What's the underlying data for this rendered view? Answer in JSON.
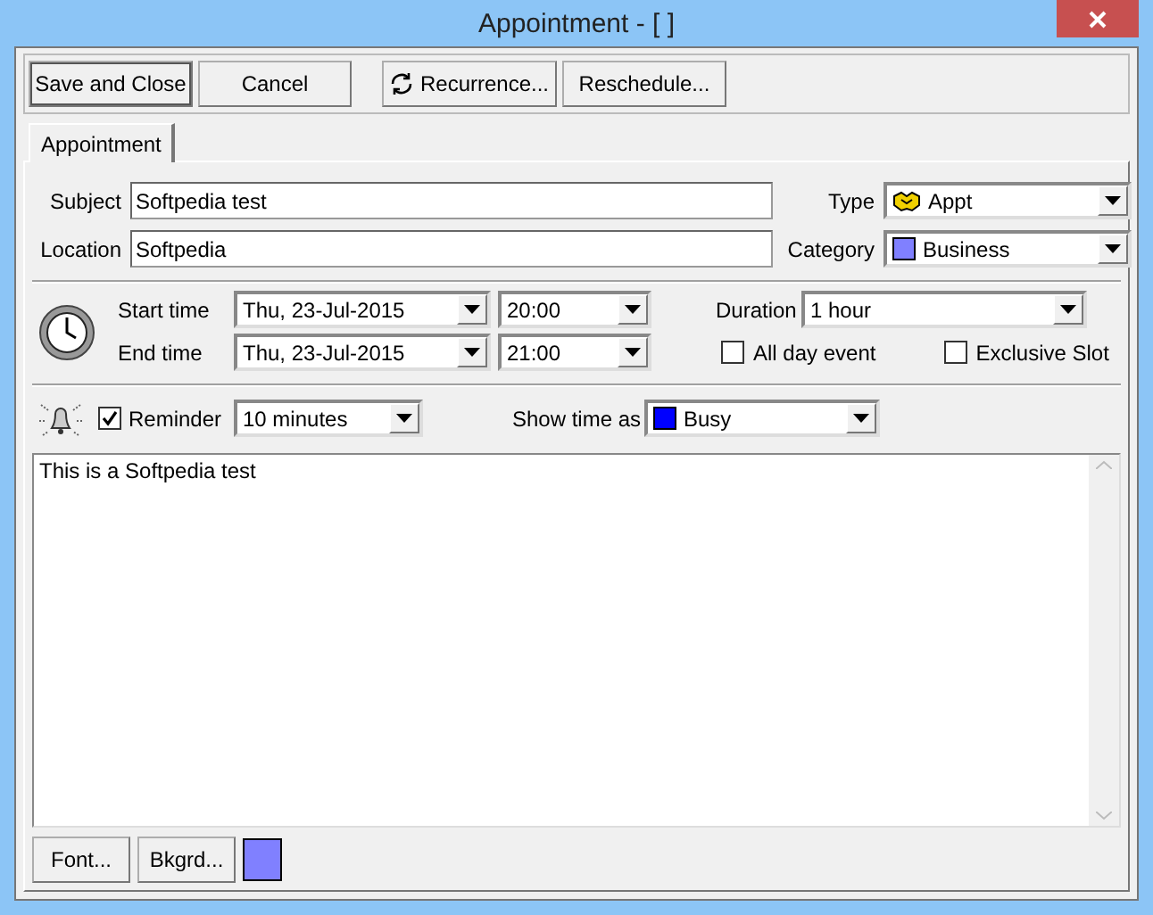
{
  "window": {
    "title": "Appointment - [  ]"
  },
  "toolbar": [
    {
      "label": "Save and Close",
      "kind": "default"
    },
    {
      "label": "Cancel",
      "kind": "plain"
    },
    {
      "label": "Recurrence...",
      "kind": "recur"
    },
    {
      "label": "Reschedule...",
      "kind": "plain"
    }
  ],
  "tabs": [
    {
      "label": "Appointment",
      "selected": true
    }
  ],
  "subject": {
    "label": "Subject",
    "value": "Softpedia test"
  },
  "location": {
    "label": "Location",
    "value": "Softpedia"
  },
  "type": {
    "label": "Type",
    "value": "Appt"
  },
  "category": {
    "label": "Category",
    "value": "Business",
    "color": "#8080ff"
  },
  "start": {
    "label": "Start time",
    "date": "Thu, 23-Jul-2015",
    "time": "20:00"
  },
  "end": {
    "label": "End time",
    "date": "Thu, 23-Jul-2015",
    "time": "21:00"
  },
  "duration": {
    "label": "Duration",
    "value": "1 hour"
  },
  "all_day": {
    "label": "All day event",
    "checked": false
  },
  "exclusive": {
    "label": "Exclusive Slot",
    "checked": false
  },
  "reminder": {
    "label": "Reminder",
    "checked": true,
    "value": "10 minutes"
  },
  "show_time_as": {
    "label": "Show time as",
    "value": "Busy",
    "color": "#0000ff"
  },
  "notes": {
    "value": "This is a Softpedia test"
  },
  "footer": {
    "font_button": "Font...",
    "background_button": "Bkgrd...",
    "background_swatch": {
      "color": "#8080ff"
    }
  }
}
